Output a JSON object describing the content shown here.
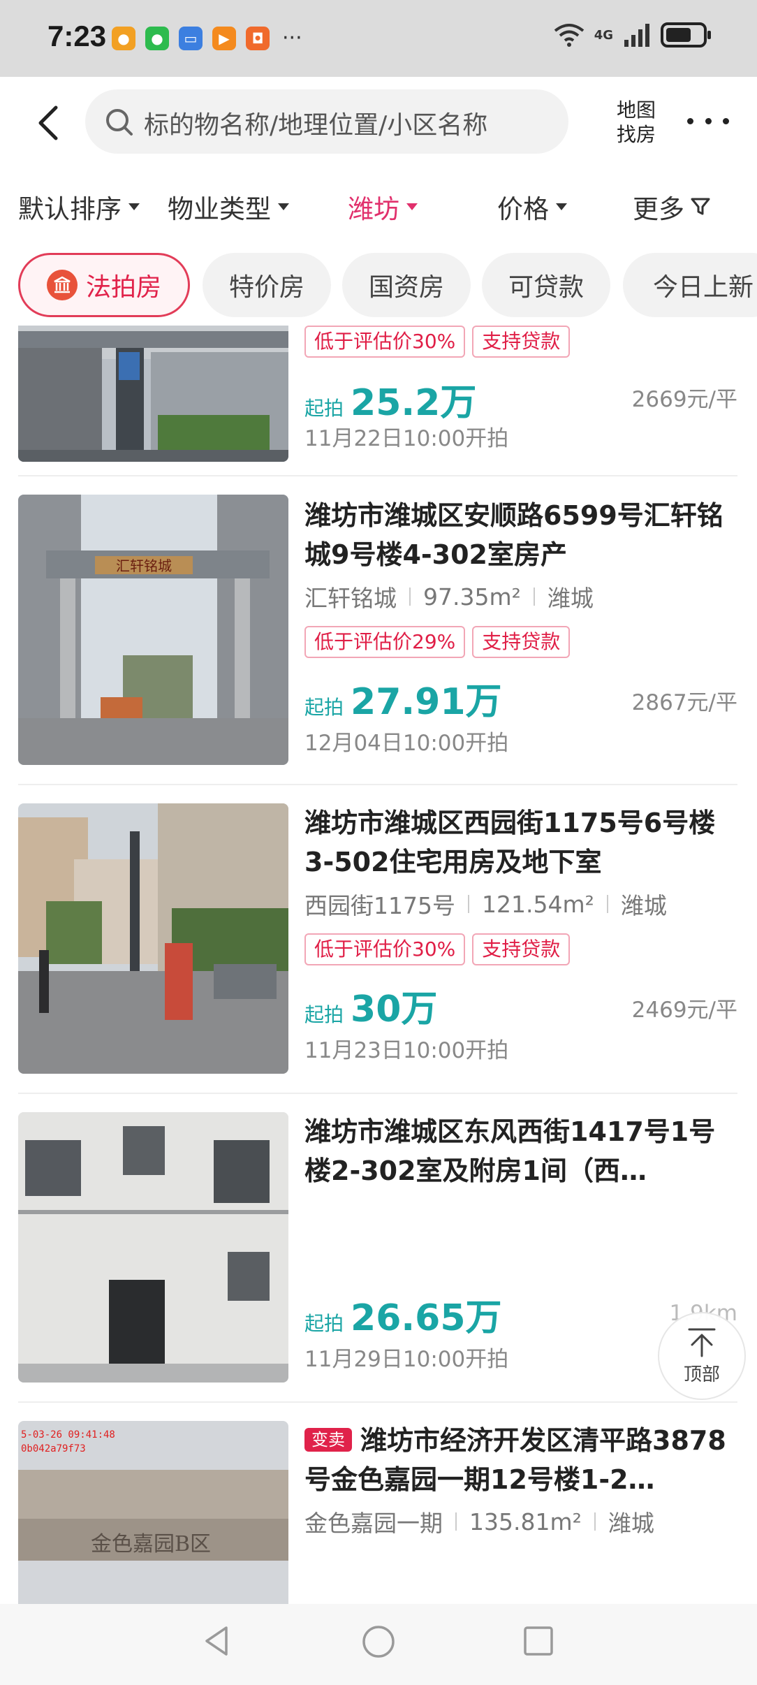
{
  "status_bar": {
    "time": "7:23",
    "more": "···",
    "network": "4G",
    "battery_level": 0.7
  },
  "header": {
    "search_placeholder": "标的物名称/地理位置/小区名称",
    "map_line1": "地图",
    "map_line2": "找房"
  },
  "filters": [
    {
      "label": "默认排序",
      "active": false
    },
    {
      "label": "物业类型",
      "active": false
    },
    {
      "label": "潍坊",
      "active": true
    },
    {
      "label": "价格",
      "active": false
    },
    {
      "label": "更多",
      "active": false
    }
  ],
  "chips": [
    {
      "label": "法拍房",
      "active": true
    },
    {
      "label": "特价房",
      "active": false
    },
    {
      "label": "国资房",
      "active": false
    },
    {
      "label": "可贷款",
      "active": false
    },
    {
      "label": "今日上新",
      "active": false
    }
  ],
  "listings": [
    {
      "title": "",
      "tags": [
        "低于评估价30%",
        "支持贷款"
      ],
      "price_label": "起拍",
      "price": "25.2万",
      "unit_price": "2669元/平",
      "date": "11月22日10:00开拍"
    },
    {
      "title": "潍坊市潍城区安顺路6599号汇轩铭城9号楼4-302室房产",
      "community": "汇轩铭城",
      "area": "97.35m²",
      "district": "潍城",
      "tags": [
        "低于评估价29%",
        "支持贷款"
      ],
      "price_label": "起拍",
      "price": "27.91万",
      "unit_price": "2867元/平",
      "date": "12月04日10:00开拍",
      "image_sign": "汇轩铭城"
    },
    {
      "title": "潍坊市潍城区西园街1175号6号楼3-502住宅用房及地下室",
      "community": "西园街1175号",
      "area": "121.54m²",
      "district": "潍城",
      "tags": [
        "低于评估价30%",
        "支持贷款"
      ],
      "price_label": "起拍",
      "price": "30万",
      "unit_price": "2469元/平",
      "date": "11月23日10:00开拍"
    },
    {
      "title": "潍坊市潍城区东风西街1417号1号楼2-302室及附房1间（西…",
      "price_label": "起拍",
      "price": "26.65万",
      "unit_price": "1.9km",
      "date": "11月29日10:00开拍"
    },
    {
      "badge": "变卖",
      "title": "潍坊市经济开发区清平路3878号金色嘉园一期12号楼1-2…",
      "community": "金色嘉园一期",
      "area": "135.81m²",
      "district": "潍城",
      "image_stamp": "5-03-26 09:41:48",
      "image_stamp2": "0b042a79f73",
      "image_sign": "金色嘉园B区"
    }
  ],
  "back_to_top": "顶部",
  "colors": {
    "accent": "#e1306c",
    "price": "#1aa5a5",
    "tag": "#e01e46"
  }
}
